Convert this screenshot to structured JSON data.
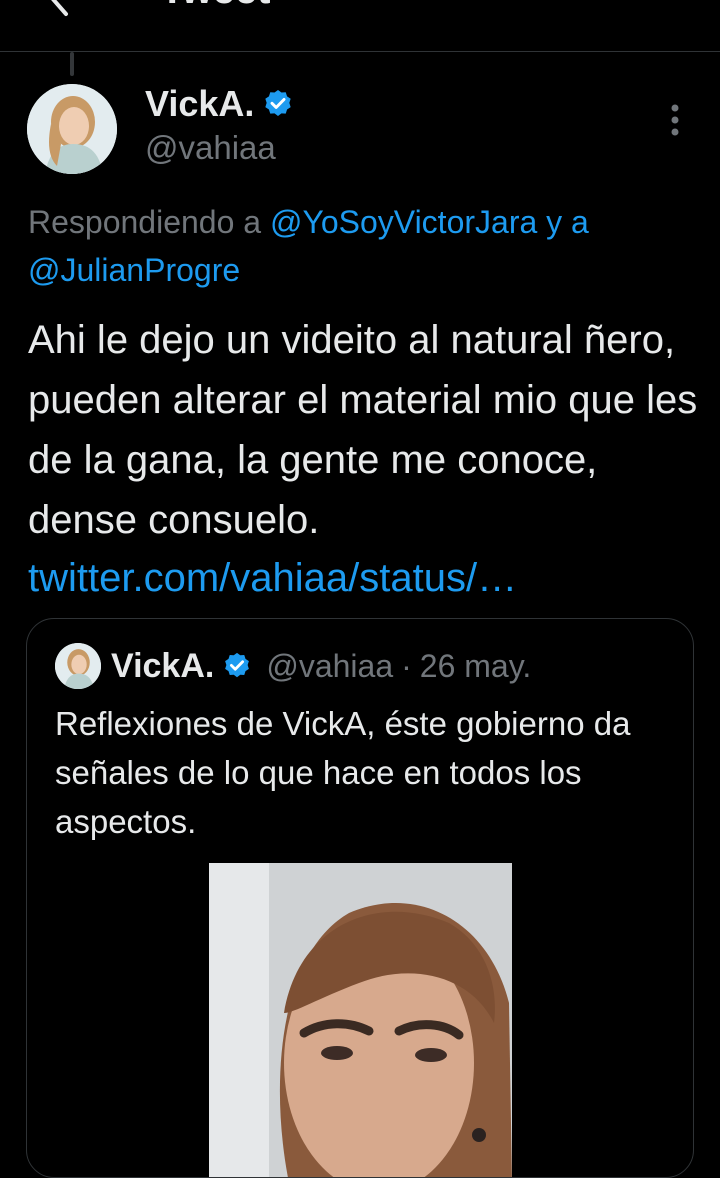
{
  "header": {
    "title": "Tweet"
  },
  "tweet": {
    "author_name": "VickA.",
    "author_handle": "@vahiaa",
    "reply_prefix": "Respondiendo a ",
    "reply_mention_1": "@YoSoyVictorJara",
    "reply_joiner": " y a ",
    "reply_mention_2": "@JulianProgre",
    "text": "Ahi le dejo un videito al natural ñero, pueden alterar el material mio que les de la gana, la gente me conoce, dense consuelo.",
    "link": "twitter.com/vahiaa/status/…"
  },
  "quoted_tweet": {
    "author_name": "VickA.",
    "author_handle": "@vahiaa",
    "separator": "·",
    "date": "26 may.",
    "text": "Reflexiones de VickA, éste gobierno da señales de lo que hace en todos los aspectos."
  },
  "icons": {
    "back": "arrow-left-icon",
    "verified": "verified-badge-icon",
    "more": "more-vertical-icon"
  },
  "colors": {
    "background": "#000000",
    "text": "#e7e9ea",
    "secondary_text": "#71767b",
    "accent": "#1d9bf0",
    "border": "#2f3336"
  }
}
